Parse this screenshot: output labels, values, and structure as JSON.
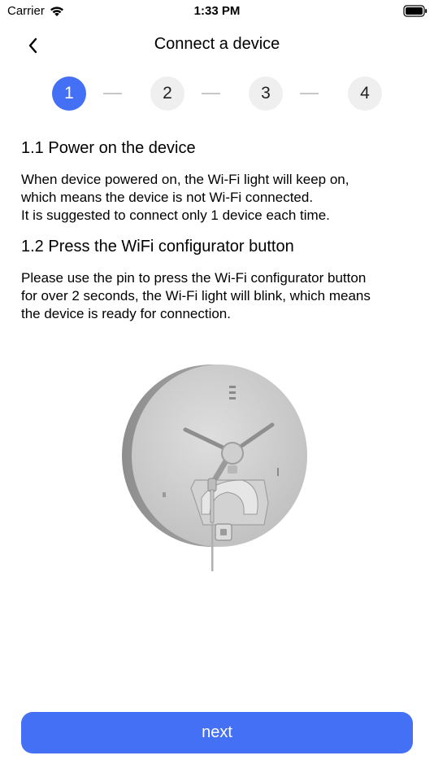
{
  "status": {
    "carrier": "Carrier",
    "time": "1:33 PM"
  },
  "nav": {
    "title": "Connect a device",
    "back_icon": "chevron-left-icon"
  },
  "stepper": {
    "steps": [
      "1",
      "2",
      "3",
      "4"
    ],
    "active_index": 0,
    "accent": "#4470f5"
  },
  "section1": {
    "title": "1.1 Power on the device",
    "body": "When device powered on,  the Wi-Fi light will keep on,\nwhich means the device is not Wi-Fi connected.\nIt is suggested to connect  only 1 device each time."
  },
  "section2": {
    "title": "1.2 Press the WiFi configurator button",
    "body": "Please use the pin to press the Wi-Fi configurator button\nfor over 2 seconds, the Wi-Fi light will blink, which means\nthe device is ready for connection."
  },
  "illustration": {
    "icon": "device-illustration"
  },
  "footer": {
    "next_label": "next"
  }
}
